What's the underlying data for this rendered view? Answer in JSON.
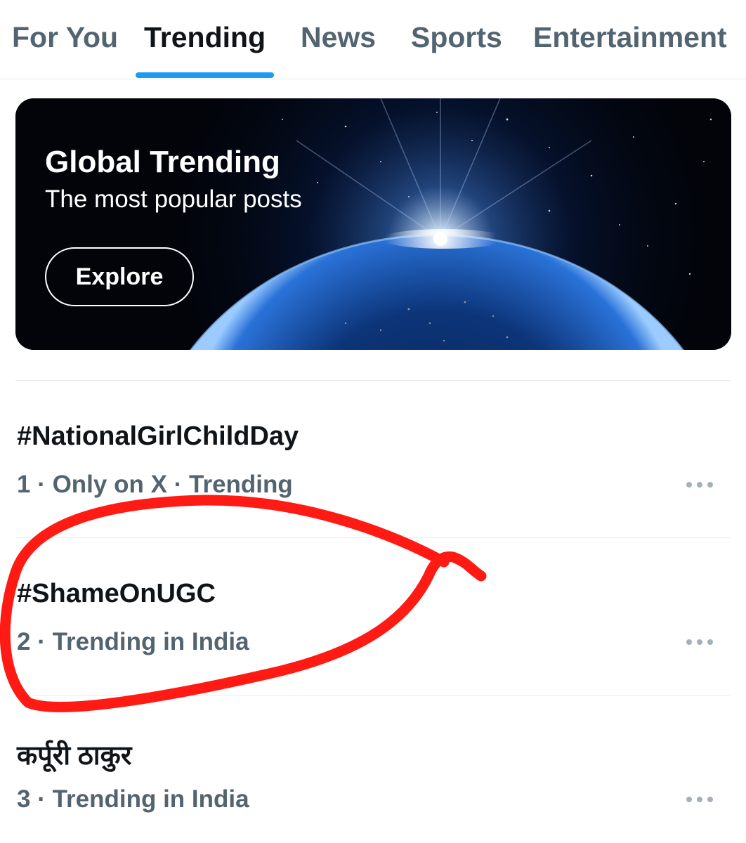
{
  "tabs": [
    {
      "label": "For You"
    },
    {
      "label": "Trending"
    },
    {
      "label": "News"
    },
    {
      "label": "Sports"
    },
    {
      "label": "Entertainment"
    }
  ],
  "active_tab": "Trending",
  "colors": {
    "accent": "#1d9bf0",
    "text_primary": "#0f1419",
    "text_secondary": "#536471",
    "annotation": "#ff1a14"
  },
  "banner": {
    "title": "Global Trending",
    "subtitle": "The most popular posts",
    "button_label": "Explore"
  },
  "trends": [
    {
      "name": "#NationalGirlChildDay",
      "rank": "1",
      "context": "Only on X · Trending",
      "meta": "1 · Only on X · Trending",
      "more_icon": "more-horizontal-icon"
    },
    {
      "name": "#ShameOnUGC",
      "rank": "2",
      "context": "Trending in India",
      "meta": "2 · Trending in India",
      "more_icon": "more-horizontal-icon"
    },
    {
      "name": "कर्पूरी ठाकुर",
      "rank": "3",
      "context": "Trending in India",
      "meta": "3 · Trending in India",
      "more_icon": "more-horizontal-icon"
    }
  ],
  "annotation": {
    "type": "hand-drawn red circle",
    "highlights": "#ShameOnUGC"
  }
}
